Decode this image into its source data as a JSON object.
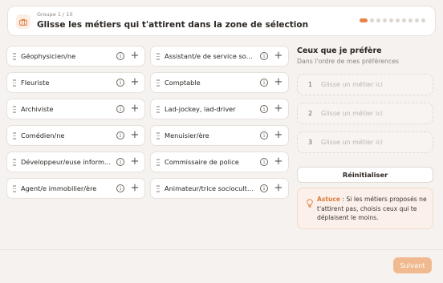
{
  "header": {
    "group_label": "Groupe 1 / 10",
    "title": "Glisse les métiers qui t'attirent dans la zone de sélection",
    "progress": {
      "current": 1,
      "total": 10
    },
    "icon": "briefcase-icon",
    "accent": "#e8834a"
  },
  "jobs": {
    "left": [
      "Géophysicien/ne",
      "Fleuriste",
      "Archiviste",
      "Comédien/ne",
      "Développeur/euse informatique",
      "Agent/e immobilier/ère"
    ],
    "right": [
      "Assistant/e de service social",
      "Comptable",
      "Lad-jockey, lad-driver",
      "Menuisier/ère",
      "Commissaire de police",
      "Animateur/trice socioculturel/le"
    ]
  },
  "preferences": {
    "title": "Ceux que je préfère",
    "subtitle": "Dans l'ordre de mes préférences",
    "slots": [
      {
        "num": "1",
        "placeholder": "Glisse un métier ici"
      },
      {
        "num": "2",
        "placeholder": "Glisse un métier ici"
      },
      {
        "num": "3",
        "placeholder": "Glisse un métier ici"
      }
    ],
    "reset_label": "Réinitialiser"
  },
  "tip": {
    "label": "Astuce",
    "text": " : Si les métiers proposés ne t'attirent pas, choisis ceux qui te déplaisent le moins.",
    "icon": "lightbulb-icon"
  },
  "footer": {
    "next_label": "Suivant",
    "next_color": "#f0b98f"
  }
}
